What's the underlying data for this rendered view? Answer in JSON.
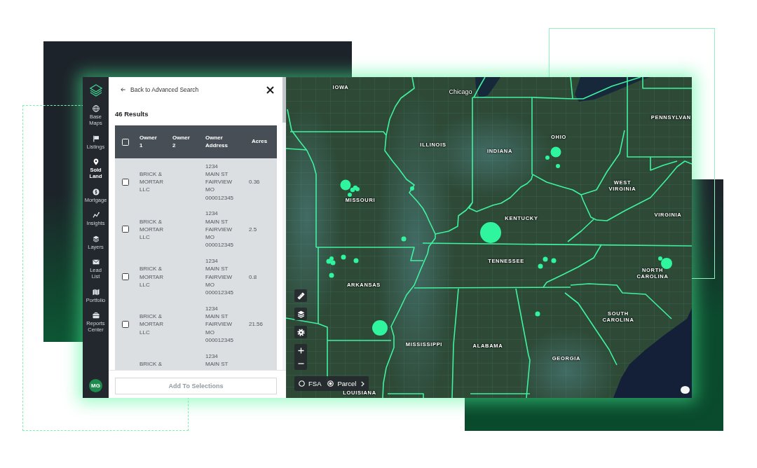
{
  "sidebar": {
    "items": [
      {
        "label": "Base Maps",
        "selected": false
      },
      {
        "label": "Listings",
        "selected": false
      },
      {
        "label": "Sold Land",
        "selected": true
      },
      {
        "label": "Mortgage",
        "selected": false
      },
      {
        "label": "Insights",
        "selected": false
      },
      {
        "label": "Layers",
        "selected": false
      },
      {
        "label": "Lead List",
        "selected": false
      },
      {
        "label": "Portfolio",
        "selected": false
      },
      {
        "label": "Reports Center",
        "selected": false
      }
    ],
    "avatar": "MG"
  },
  "panel": {
    "back_link": "Back to Advanced Search",
    "results_count": "46 Results",
    "table": {
      "select_all_checked": false,
      "columns": [
        "Owner 1",
        "Owner 2",
        "Owner Address",
        "Acres"
      ],
      "rows": [
        {
          "checked": false,
          "owner_1": "BRICK & MORTAR LLC",
          "owner_address": "1234\nMAIN ST\nFAIRVIEW\nMO\n000012345",
          "acres": "0.36"
        },
        {
          "checked": false,
          "owner_1": "BRICK & MORTAR LLC",
          "owner_address": "1234\nMAIN ST\nFAIRVIEW\nMO\n000012345",
          "acres": "2.5"
        },
        {
          "checked": false,
          "owner_1": "BRICK & MORTAR LLC",
          "owner_address": "1234\nMAIN ST\nFAIRVIEW\nMO\n000012345",
          "acres": "0.8"
        },
        {
          "checked": false,
          "owner_1": "BRICK & MORTAR LLC",
          "owner_address": "1234\nMAIN ST\nFAIRVIEW\nMO\n000012345",
          "acres": "21.56"
        },
        {
          "owner_1": "BRICK &",
          "owner_address": "1234\nMAIN ST"
        }
      ]
    },
    "add_button": {
      "label": "Add To Selections",
      "disabled": true
    }
  },
  "map": {
    "labels": [
      {
        "text": "IOWA",
        "kind": "state"
      },
      {
        "text": "Chicago",
        "kind": "city"
      },
      {
        "text": "PENNSYLVAN",
        "kind": "state"
      },
      {
        "text": "OHIO",
        "kind": "state"
      },
      {
        "text": "ILLINOIS",
        "kind": "state"
      },
      {
        "text": "INDIANA",
        "kind": "state"
      },
      {
        "text": "WEST VIRGINIA",
        "kind": "state"
      },
      {
        "text": "MISSOURI",
        "kind": "state"
      },
      {
        "text": "VIRGINIA",
        "kind": "state"
      },
      {
        "text": "KENTUCKY",
        "kind": "state"
      },
      {
        "text": "TENNESSEE",
        "kind": "state"
      },
      {
        "text": "NORTH CAROLINA",
        "kind": "state"
      },
      {
        "text": "ARKANSAS",
        "kind": "state"
      },
      {
        "text": "SOUTH CAROLINA",
        "kind": "state"
      },
      {
        "text": "MISSISSIPPI",
        "kind": "state"
      },
      {
        "text": "ALABAMA",
        "kind": "state"
      },
      {
        "text": "GEORGIA",
        "kind": "state"
      },
      {
        "text": "LOUISIANA",
        "kind": "state"
      }
    ],
    "layer_toggle": [
      {
        "label": "FSA",
        "selected": false
      },
      {
        "label": "Parcel",
        "selected": true
      }
    ]
  }
}
